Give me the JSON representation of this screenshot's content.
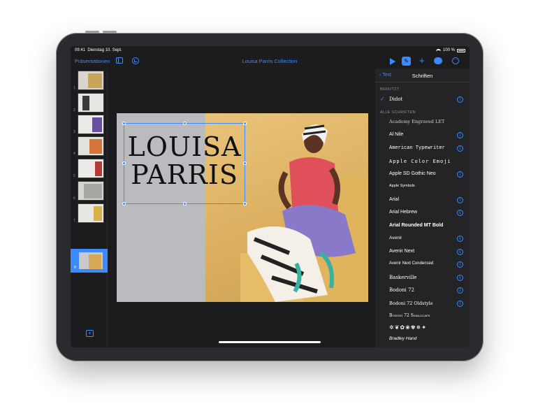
{
  "status_bar": {
    "time": "09:41",
    "date": "Dienstag 10. Sept.",
    "battery": "100 %"
  },
  "toolbar": {
    "back_label": "Präsentationen",
    "title": "Louisa Parris Collection",
    "icons": [
      "sidebar-icon",
      "undo-icon",
      "play-icon",
      "paintbrush-icon",
      "plus-icon",
      "collaborate-icon",
      "more-icon"
    ]
  },
  "navigator": {
    "slides": [
      {
        "number": "1"
      },
      {
        "number": "2"
      },
      {
        "number": "3"
      },
      {
        "number": "4"
      },
      {
        "number": "5"
      },
      {
        "number": "6"
      },
      {
        "number": "7"
      },
      {
        "number": "8",
        "selected": true
      }
    ]
  },
  "slide": {
    "title_line1": "LOUISA",
    "title_line2": "PARRIS"
  },
  "panel": {
    "back_label": "Text",
    "title": "Schriften",
    "used_section": "BENUTZT",
    "used_font": "Didot",
    "all_section": "ALLE SCHRIFTEN",
    "fonts": [
      {
        "name": "Academy Engraved LET",
        "info": false
      },
      {
        "name": "Al Nile",
        "info": true
      },
      {
        "name": "American Typewriter",
        "info": true
      },
      {
        "name": "Apple Color Emoji",
        "info": false
      },
      {
        "name": "Apple SD Gothic Neo",
        "info": true
      },
      {
        "name": "Apple Symbols",
        "info": false
      },
      {
        "name": "Arial",
        "info": true
      },
      {
        "name": "Arial Hebrew",
        "info": true
      },
      {
        "name": "Arial Rounded MT Bold",
        "info": false
      },
      {
        "name": "Avenir",
        "info": true
      },
      {
        "name": "Avenir Next",
        "info": true
      },
      {
        "name": "Avenir Next Condensed",
        "info": true
      },
      {
        "name": "Baskerville",
        "info": true
      },
      {
        "name": "Bodoni 72",
        "info": true
      },
      {
        "name": "Bodoni 72 Oldstyle",
        "info": true
      },
      {
        "name": "Bodoni 72 Smallcaps",
        "info": false
      },
      {
        "name": "Bodoni Ornaments",
        "info": false
      },
      {
        "name": "Bradley Hand",
        "info": false
      }
    ]
  },
  "colors": {
    "accent": "#3a8bff",
    "panel_bg": "#242426",
    "canvas_bg": "#1c1c1e"
  }
}
